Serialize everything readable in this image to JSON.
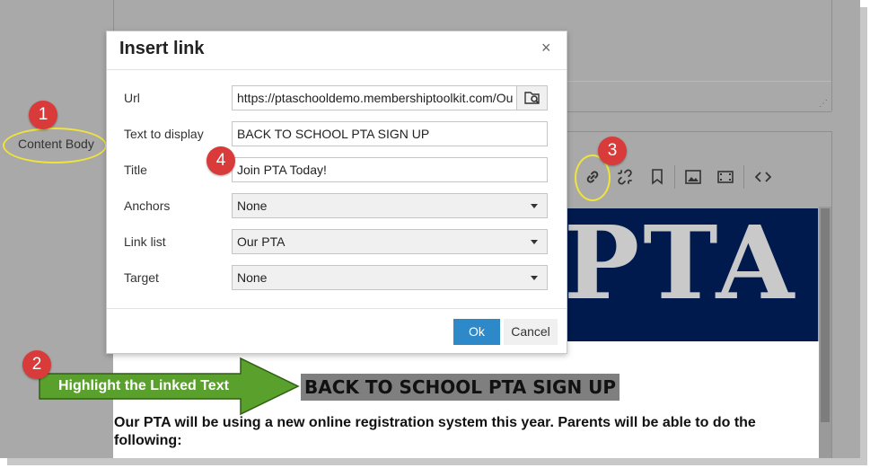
{
  "sidebar": {
    "content_body_label": "Content Body"
  },
  "dialog": {
    "title": "Insert link",
    "close_symbol": "×",
    "fields": {
      "url": {
        "label": "Url",
        "value": "https://ptaschooldemo.membershiptoolkit.com/Ou"
      },
      "text": {
        "label": "Text to display",
        "value": "BACK TO SCHOOL PTA SIGN UP"
      },
      "title": {
        "label": "Title",
        "value": "Join PTA Today!"
      },
      "anchors": {
        "label": "Anchors",
        "value": "None"
      },
      "linklist": {
        "label": "Link list",
        "value": "Our PTA"
      },
      "target": {
        "label": "Target",
        "value": "None"
      }
    },
    "ok_label": "Ok",
    "cancel_label": "Cancel"
  },
  "annotations": {
    "badge1": "1",
    "badge2": "2",
    "badge3": "3",
    "badge4": "4",
    "arrow_text": "Highlight the Linked Text"
  },
  "editor": {
    "banner_text": "PTA",
    "heading": "BACK TO SCHOOL PTA SIGN UP",
    "body": "Our PTA will be using a new online registration system this year. Parents will be able to do the following:"
  },
  "toolbar_icons": [
    "link-icon",
    "unlink-icon",
    "bookmark-icon",
    "image-icon",
    "media-icon",
    "code-icon"
  ],
  "colors": {
    "accent": "#2d89c8",
    "badge": "#d93a3a",
    "highlight_ring": "#f0e43a",
    "arrow": "#5aa02c",
    "banner": "#001a4d"
  }
}
